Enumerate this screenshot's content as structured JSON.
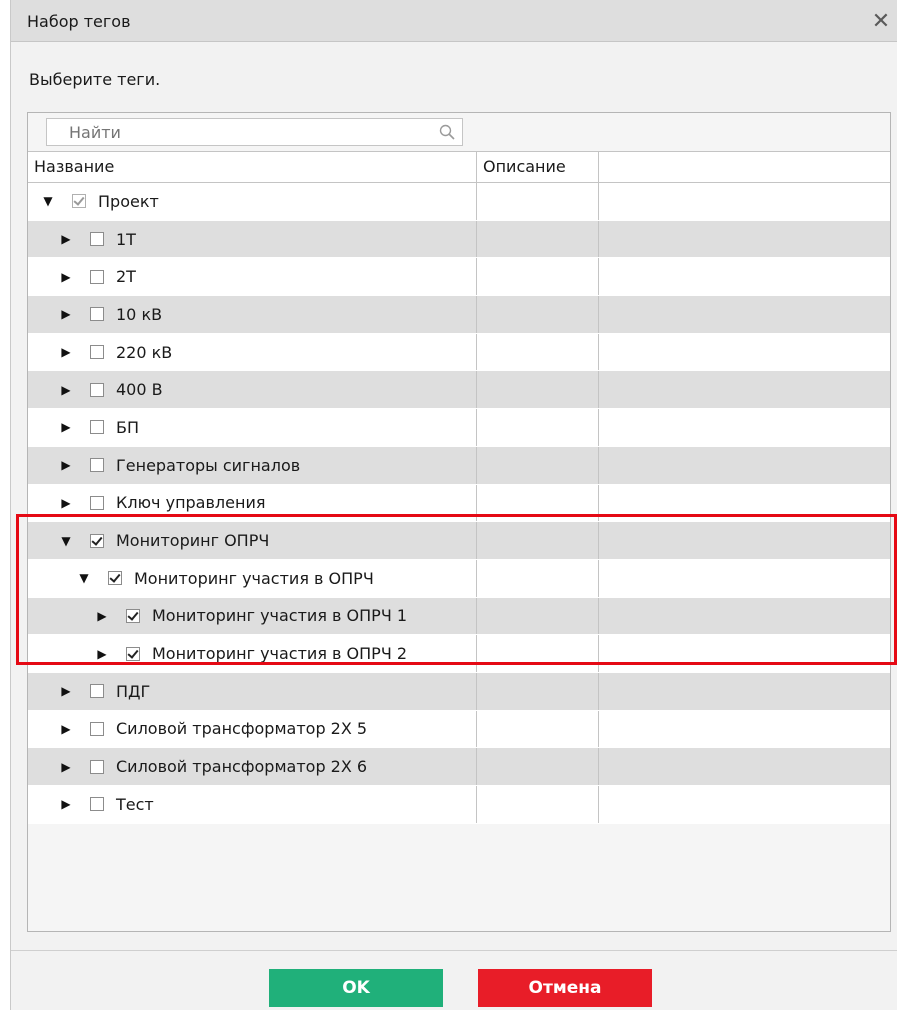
{
  "dialog": {
    "title": "Набор тегов",
    "instruction": "Выберите теги.",
    "search": {
      "placeholder": "Найти"
    },
    "columns": {
      "name": "Название",
      "description": "Описание"
    },
    "buttons": {
      "ok": "OK",
      "cancel": "Отмена"
    }
  },
  "colors": {
    "highlight": "#e50914",
    "ok": "#20b07a",
    "cancel": "#e81d28"
  },
  "tree": [
    {
      "label": "Проект",
      "level": 0,
      "expanded": true,
      "checked": true,
      "disabled_look": true
    },
    {
      "label": "1Т",
      "level": 1,
      "expanded": false,
      "checked": false
    },
    {
      "label": "2Т",
      "level": 1,
      "expanded": false,
      "checked": false
    },
    {
      "label": "10 кВ",
      "level": 1,
      "expanded": false,
      "checked": false
    },
    {
      "label": "220 кВ",
      "level": 1,
      "expanded": false,
      "checked": false
    },
    {
      "label": "400 В",
      "level": 1,
      "expanded": false,
      "checked": false
    },
    {
      "label": "БП",
      "level": 1,
      "expanded": false,
      "checked": false
    },
    {
      "label": "Генераторы сигналов",
      "level": 1,
      "expanded": false,
      "checked": false
    },
    {
      "label": "Ключ управления",
      "level": 1,
      "expanded": false,
      "checked": false
    },
    {
      "label": "Мониторинг ОПРЧ",
      "level": 1,
      "expanded": true,
      "checked": true
    },
    {
      "label": "Мониторинг участия в ОПРЧ",
      "level": 2,
      "expanded": true,
      "checked": true
    },
    {
      "label": "Мониторинг участия в ОПРЧ 1",
      "level": 3,
      "expanded": false,
      "checked": true
    },
    {
      "label": "Мониторинг участия в ОПРЧ 2",
      "level": 3,
      "expanded": false,
      "checked": true
    },
    {
      "label": "ПДГ",
      "level": 1,
      "expanded": false,
      "checked": false
    },
    {
      "label": "Силовой трансформатор 2Х 5",
      "level": 1,
      "expanded": false,
      "checked": false
    },
    {
      "label": "Силовой трансформатор 2Х 6",
      "level": 1,
      "expanded": false,
      "checked": false
    },
    {
      "label": "Тест",
      "level": 1,
      "expanded": false,
      "checked": false
    }
  ]
}
